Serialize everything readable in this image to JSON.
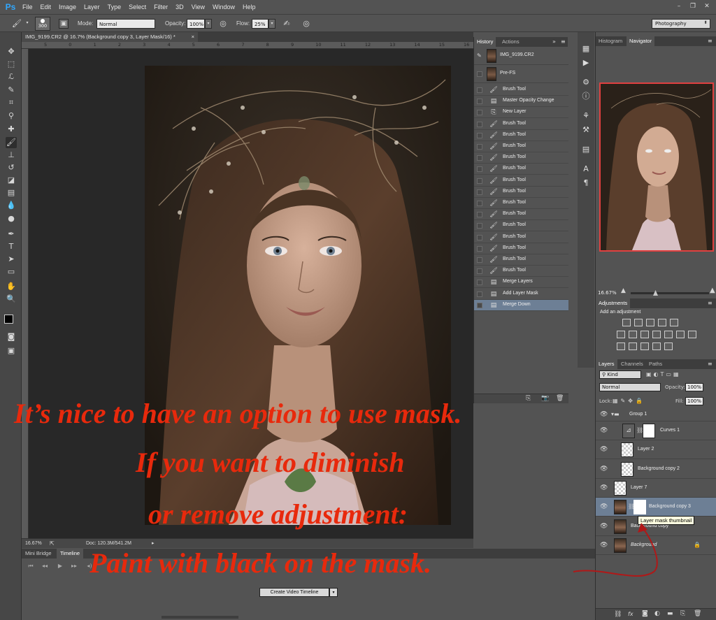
{
  "app": {
    "logo": "Ps"
  },
  "menu": [
    "File",
    "Edit",
    "Image",
    "Layer",
    "Type",
    "Select",
    "Filter",
    "3D",
    "View",
    "Window",
    "Help"
  ],
  "window_controls": {
    "minimize": "–",
    "restore": "❐",
    "close": "✕"
  },
  "options_bar": {
    "brush_size": "300",
    "mode_label": "Mode:",
    "mode_value": "Normal",
    "opacity_label": "Opacity:",
    "opacity_value": "100%",
    "flow_label": "Flow:",
    "flow_value": "25%",
    "workspace": "Photography"
  },
  "document": {
    "tab_title": "IMG_9199.CR2 @ 16.7% (Background copy 3, Layer Mask/16) *",
    "ruler_numbers": [
      "5",
      "0",
      "1",
      "2",
      "3",
      "4",
      "5",
      "6",
      "7",
      "8",
      "9",
      "10",
      "11",
      "12",
      "13",
      "14",
      "15",
      "16"
    ]
  },
  "status_bar": {
    "zoom": "16.67%",
    "doc_info": "Doc: 120.3M/541.2M"
  },
  "timeline": {
    "tabs": [
      "Mini Bridge",
      "Timeline"
    ],
    "create_button": "Create Video Timeline"
  },
  "history_panel": {
    "tabs": [
      "History",
      "Actions"
    ],
    "snapshots": [
      "IMG_9199.CR2",
      "Pre-FS"
    ],
    "steps": [
      "Brush Tool",
      "Master Opacity Change",
      "New Layer",
      "Brush Tool",
      "Brush Tool",
      "Brush Tool",
      "Brush Tool",
      "Brush Tool",
      "Brush Tool",
      "Brush Tool",
      "Brush Tool",
      "Brush Tool",
      "Brush Tool",
      "Brush Tool",
      "Brush Tool",
      "Brush Tool",
      "Brush Tool",
      "Merge Layers",
      "Add Layer Mask",
      "Merge Down"
    ],
    "selected_step": "Merge Down"
  },
  "navigator_panel": {
    "tabs": [
      "Histogram",
      "Navigator"
    ],
    "zoom": "16.67%"
  },
  "adjustments_panel": {
    "tab": "Adjustments",
    "heading": "Add an adjustment"
  },
  "layers_panel": {
    "tabs": [
      "Layers",
      "Channels",
      "Paths"
    ],
    "kind_filter": "Kind",
    "blend_mode": "Normal",
    "opacity_label": "Opacity:",
    "opacity_value": "100%",
    "lock_label": "Lock:",
    "fill_label": "Fill:",
    "fill_value": "100%",
    "layers": [
      {
        "name": "Group 1",
        "kind": "group"
      },
      {
        "name": "Curves 1",
        "kind": "adjustment"
      },
      {
        "name": "Layer 2",
        "kind": "transparent"
      },
      {
        "name": "Background copy 2",
        "kind": "transparent"
      },
      {
        "name": "Layer 7",
        "kind": "transparent"
      },
      {
        "name": "Background copy 3",
        "kind": "photo-mask",
        "selected": true
      },
      {
        "name": "Background copy",
        "kind": "photo"
      },
      {
        "name": "Background",
        "kind": "photo-locked"
      }
    ],
    "footer_icons": [
      "link-icon",
      "fx-icon",
      "mask-icon",
      "adjustment-icon",
      "folder-icon",
      "new-layer-icon",
      "trash-icon"
    ],
    "fx_label": "fx"
  },
  "tooltip": "Layer mask thumbnail",
  "overlay": {
    "line1": "It’s nice to have an option to use mask.",
    "line2": "If you want to diminish",
    "line3": "or remove adjustment:",
    "line4": "Paint with black on the mask.",
    "color": "#e8290c"
  }
}
